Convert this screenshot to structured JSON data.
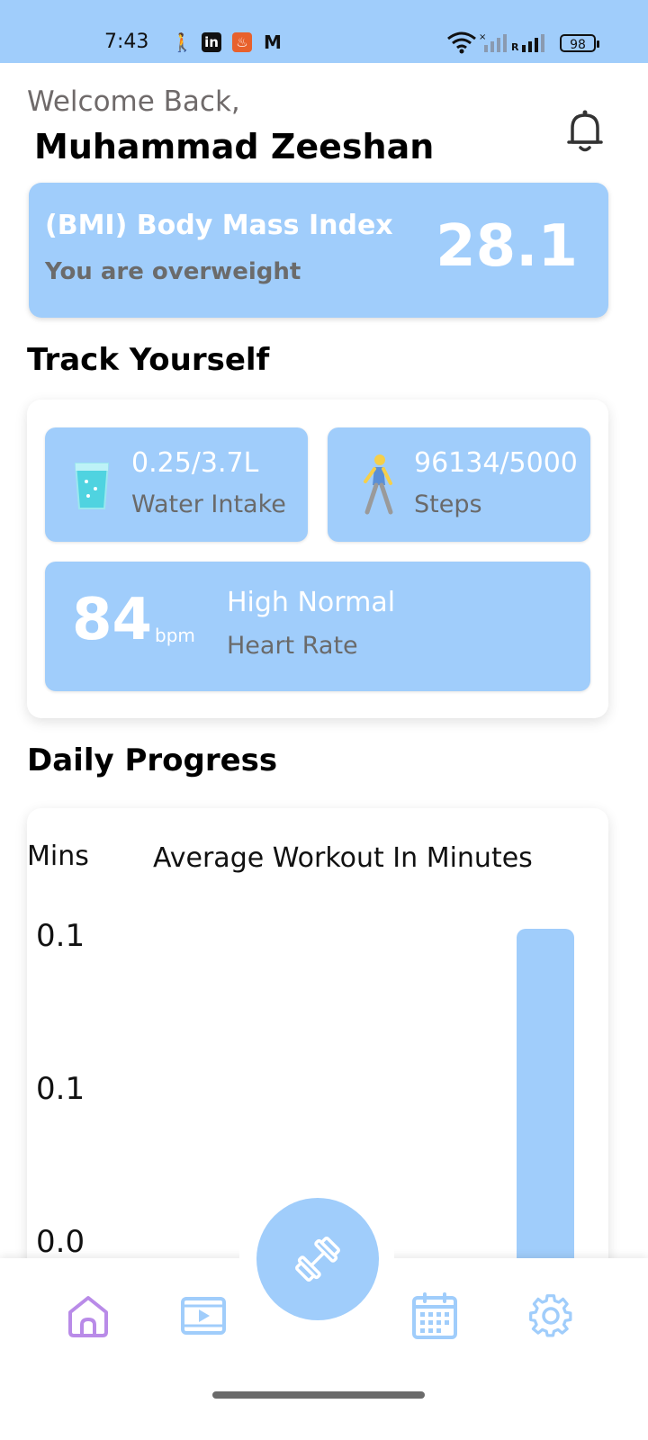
{
  "status_bar": {
    "time": "7:43",
    "battery": "98"
  },
  "header": {
    "welcome": "Welcome Back,",
    "name": "Muhammad Zeeshan"
  },
  "bmi": {
    "title": "(BMI) Body Mass Index",
    "status": "You are overweight",
    "value": "28.1"
  },
  "track": {
    "section_title": "Track Yourself",
    "water": {
      "value": "0.25/3.7L",
      "label": "Water Intake"
    },
    "steps": {
      "value": "96134/5000",
      "label": "Steps"
    },
    "heart": {
      "value": "84",
      "unit": "bpm",
      "status": "High Normal",
      "label": "Heart Rate"
    }
  },
  "progress": {
    "section_title": "Daily Progress"
  },
  "chart_data": {
    "type": "bar",
    "title": "Average Workout In Minutes",
    "ylabel": "Mins",
    "xlabel": "",
    "ytick_labels": [
      "0.1",
      "0.1",
      "0.0"
    ],
    "categories": [
      "",
      "",
      "",
      "",
      "",
      ""
    ],
    "values": [
      0,
      0,
      0,
      0,
      0,
      0.1
    ],
    "ylim": [
      0,
      0.1
    ]
  },
  "colors": {
    "accent": "#a0cdfb",
    "home_icon": "#b98be8"
  },
  "icons": {
    "status": [
      "runner-icon",
      "linkedin-icon",
      "fire-icon",
      "gmail-icon",
      "wifi-icon",
      "signal-icon",
      "battery-icon"
    ],
    "nav": [
      "home-icon",
      "video-icon",
      "dumbbell-icon",
      "calendar-icon",
      "gear-icon"
    ]
  }
}
